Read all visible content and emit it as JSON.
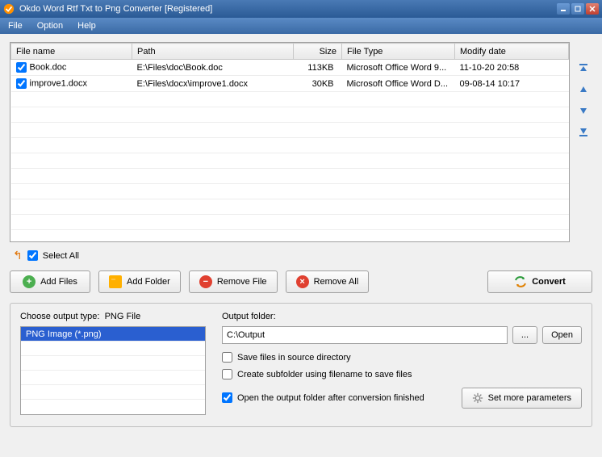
{
  "window": {
    "title": "Okdo Word Rtf Txt to Png Converter [Registered]"
  },
  "menu": {
    "file": "File",
    "option": "Option",
    "help": "Help"
  },
  "table": {
    "headers": {
      "name": "File name",
      "path": "Path",
      "size": "Size",
      "type": "File Type",
      "date": "Modify date"
    },
    "rows": [
      {
        "checked": true,
        "name": "Book.doc",
        "path": "E:\\Files\\doc\\Book.doc",
        "size": "113KB",
        "type": "Microsoft Office Word 9...",
        "date": "11-10-20 20:58"
      },
      {
        "checked": true,
        "name": "improve1.docx",
        "path": "E:\\Files\\docx\\improve1.docx",
        "size": "30KB",
        "type": "Microsoft Office Word D...",
        "date": "09-08-14 10:17"
      }
    ]
  },
  "selectAll": {
    "label": "Select All",
    "checked": true
  },
  "buttons": {
    "addFiles": "Add Files",
    "addFolder": "Add Folder",
    "removeFile": "Remove File",
    "removeAll": "Remove All",
    "convert": "Convert",
    "browse": "...",
    "open": "Open",
    "moreParams": "Set more parameters"
  },
  "output": {
    "typeLabel": "Choose output type:",
    "typeValue": "PNG File",
    "typeOption": "PNG Image (*.png)",
    "folderLabel": "Output folder:",
    "folderValue": "C:\\Output",
    "saveSource": {
      "label": "Save files in source directory",
      "checked": false
    },
    "createSub": {
      "label": "Create subfolder using filename to save files",
      "checked": false
    },
    "openAfter": {
      "label": "Open the output folder after conversion finished",
      "checked": true
    }
  }
}
